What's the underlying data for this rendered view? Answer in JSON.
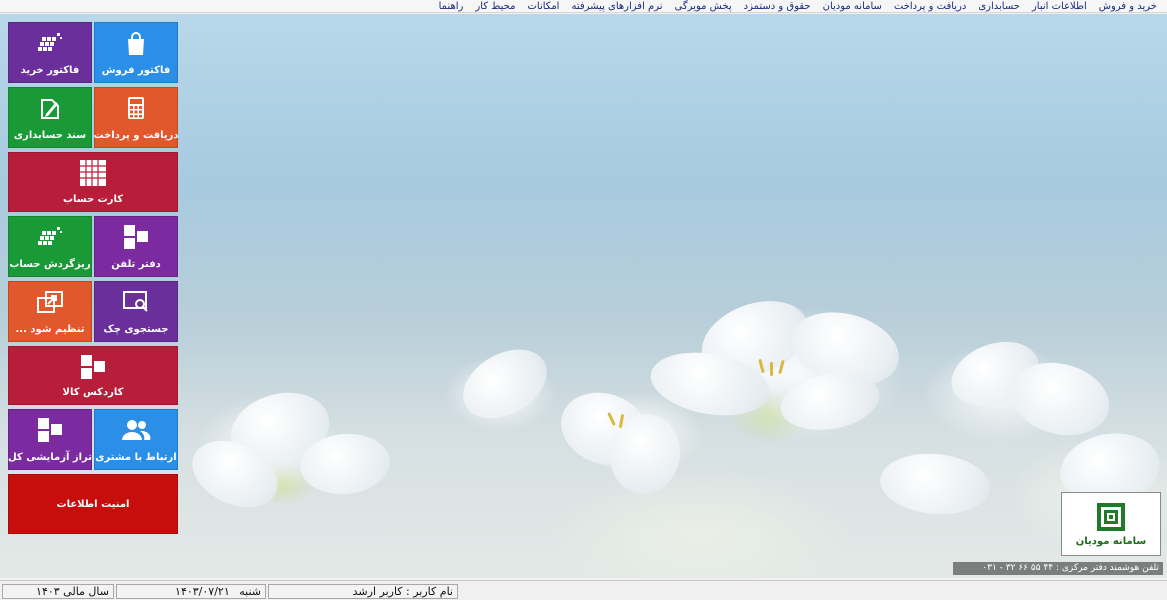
{
  "menu": [
    "خرید و فروش",
    "اطلاعات انبار",
    "حسابداری",
    "دریافت و پرداخت",
    "سامانه مودیان",
    "حقوق و دستمزد",
    "پخش مویرگی",
    "نرم افزارهای پیشرفته",
    "امکانات",
    "محیط کار",
    "راهنما"
  ],
  "tiles": {
    "sales_invoice": "فاکتور فروش",
    "purchase_invoice": "فاکتور خرید",
    "receive_pay": "دریافت و پرداخت",
    "voucher": "سند حسابداری",
    "account_card": "کارت حساب",
    "phonebook": "دفتر تلفن",
    "account_turnover": "ریزگردش حساب",
    "cheque_search": "جستجوی چک",
    "settings": "تنظیم شود ...",
    "item_cardex": "کاردکس کالا",
    "customer_contact": "ارتباط با مشتری",
    "trial_balance": "تراز آزمایشی کل",
    "security": "امنیت اطلاعات"
  },
  "modian": {
    "label": "سامانه مودیان"
  },
  "phone": "تلفن هوشمند دفتر مرکزی : ۴۴ ۵۵ ۶۶ ۳۲ - ۰۳۱",
  "status": {
    "user": "نام کاربر : کاربر ارشد",
    "day": "شنبه",
    "date": "۱۴۰۳/۰۷/۲۱",
    "fiscal_year": "سال مالی ۱۴۰۳"
  },
  "colors": {
    "blue": "#2b8fe8",
    "purple": "#6a2f9a",
    "green": "#1a9a37",
    "orange": "#e0582b",
    "crimson": "#b81e3a",
    "red": "#c80d0d"
  }
}
